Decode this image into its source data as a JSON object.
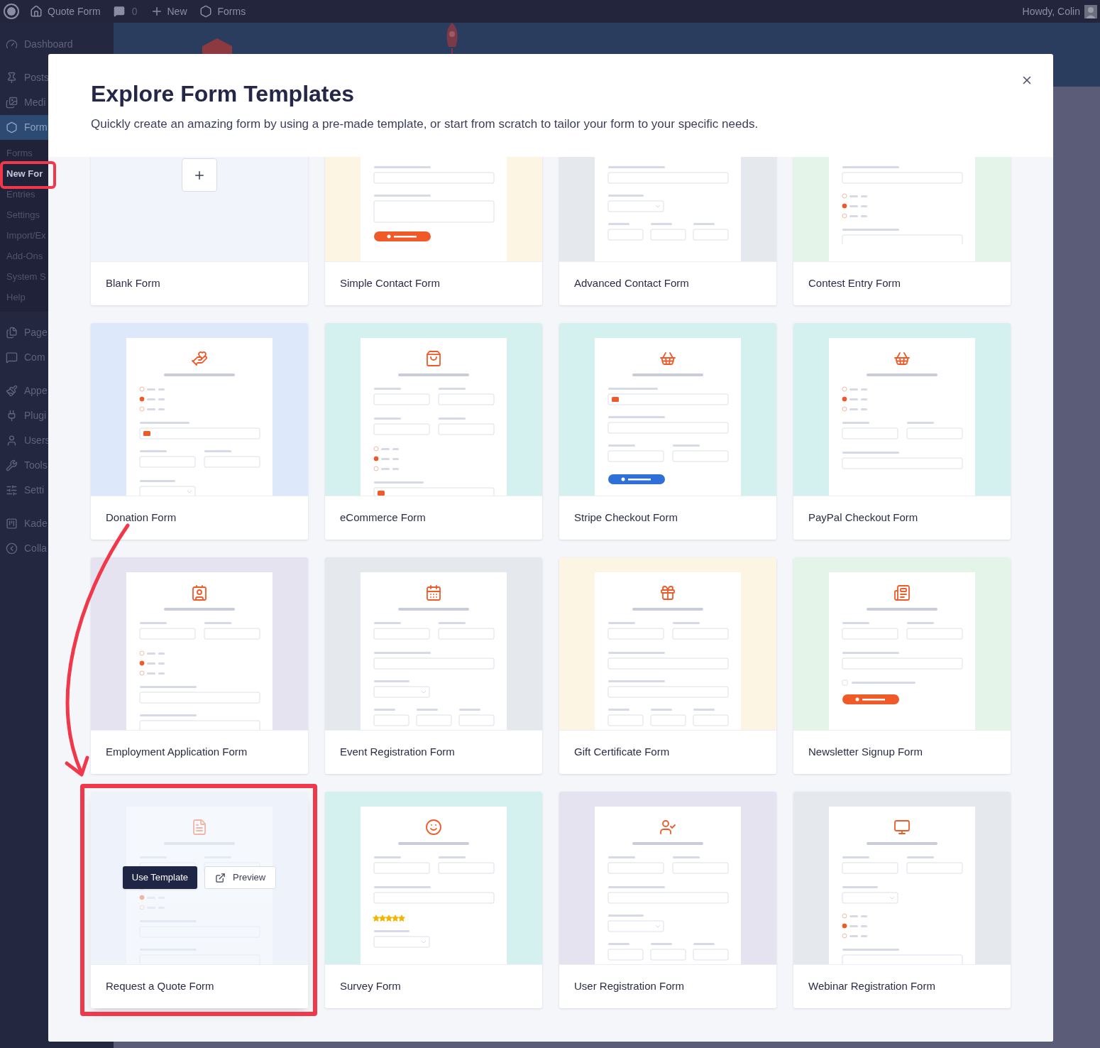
{
  "admin_bar": {
    "site": "Quote Form",
    "comments": "0",
    "new": "New",
    "forms": "Forms",
    "greeting": "Howdy, Colin"
  },
  "sidebar": {
    "groups": [
      [
        {
          "label": "Dashboard",
          "selected": false
        }
      ],
      [
        {
          "label": "Posts",
          "selected": false
        },
        {
          "label": "Medi",
          "selected": false
        },
        {
          "label": "Form",
          "selected": true,
          "children": [
            {
              "label": "Forms",
              "selected": false
            },
            {
              "label": "New For",
              "selected": true
            },
            {
              "label": "Entries",
              "selected": false
            },
            {
              "label": "Settings",
              "selected": false
            },
            {
              "label": "Import/Ex",
              "selected": false
            },
            {
              "label": "Add-Ons",
              "selected": false
            },
            {
              "label": "System S",
              "selected": false
            },
            {
              "label": "Help",
              "selected": false
            }
          ]
        }
      ],
      [
        {
          "label": "Page",
          "selected": false
        },
        {
          "label": "Com",
          "selected": false
        }
      ],
      [
        {
          "label": "Appe",
          "selected": false
        },
        {
          "label": "Plugi",
          "selected": false
        },
        {
          "label": "Users",
          "selected": false
        },
        {
          "label": "Tools",
          "selected": false
        },
        {
          "label": "Setti",
          "selected": false
        }
      ],
      [
        {
          "label": "Kade",
          "selected": false
        },
        {
          "label": "Colla",
          "selected": false
        }
      ]
    ]
  },
  "modal": {
    "title": "Explore Form Templates",
    "subtitle": "Quickly create an amazing form by using a pre-made template, or start from scratch to tailor your form to your specific needs.",
    "hover_actions": {
      "use": "Use Template",
      "preview": "Preview"
    },
    "templates": [
      {
        "name": "Blank Form",
        "kind": "blank",
        "color": "#f1f5fb",
        "hovered": false
      },
      {
        "name": "Simple Contact Form",
        "kind": "template",
        "color": "#fcf5e3",
        "hovered": false
      },
      {
        "name": "Advanced Contact Form",
        "kind": "template",
        "color": "#e5e9ed",
        "hovered": false
      },
      {
        "name": "Contest Entry Form",
        "kind": "template",
        "color": "#e5f4e9",
        "hovered": false
      },
      {
        "name": "Donation Form",
        "kind": "template",
        "color": "#dde9fb",
        "hovered": false
      },
      {
        "name": "eCommerce Form",
        "kind": "template",
        "color": "#d4f0ef",
        "hovered": false
      },
      {
        "name": "Stripe Checkout Form",
        "kind": "template",
        "color": "#d4f0ef",
        "hovered": false
      },
      {
        "name": "PayPal Checkout Form",
        "kind": "template",
        "color": "#d4f0ef",
        "hovered": false
      },
      {
        "name": "Employment Application Form",
        "kind": "template",
        "color": "#e6e3f1",
        "hovered": false
      },
      {
        "name": "Event Registration Form",
        "kind": "template",
        "color": "#e5e9ed",
        "hovered": false
      },
      {
        "name": "Gift Certificate Form",
        "kind": "template",
        "color": "#fcf5e3",
        "hovered": false
      },
      {
        "name": "Newsletter Signup Form",
        "kind": "template",
        "color": "#e5f4e9",
        "hovered": false
      },
      {
        "name": "Request a Quote Form",
        "kind": "template",
        "color": "#eef3fb",
        "hovered": true
      },
      {
        "name": "Survey Form",
        "kind": "template",
        "color": "#d4f0ef",
        "hovered": false
      },
      {
        "name": "User Registration Form",
        "kind": "template",
        "color": "#e6e3f1",
        "hovered": false
      },
      {
        "name": "Webinar Registration Form",
        "kind": "template",
        "color": "#e5e9ed",
        "hovered": false
      }
    ]
  }
}
